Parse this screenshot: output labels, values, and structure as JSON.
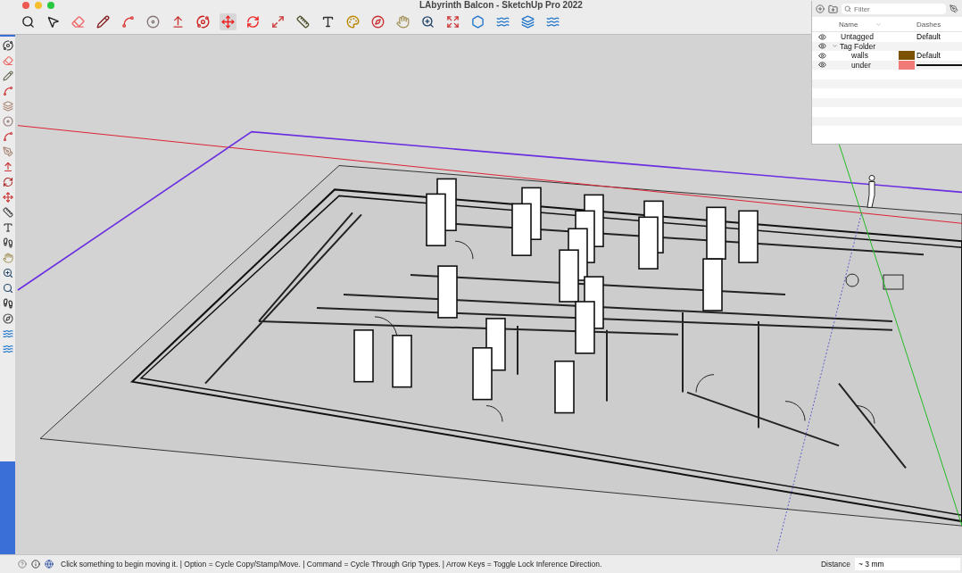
{
  "window": {
    "title": "LAbyrinth Balcon - SketchUp Pro 2022"
  },
  "tags_panel": {
    "filter": {
      "placeholder": "Filter"
    },
    "columns": [
      "Name",
      "Dashes"
    ],
    "rows": [
      {
        "name": "Untagged",
        "visible": true,
        "dashes": "Default"
      },
      {
        "name": "Tag Folder",
        "visible": true,
        "expanded": true,
        "children": [
          {
            "name": "walls",
            "visible": true,
            "color": "#7a5200",
            "dashes": "Default"
          },
          {
            "name": "under",
            "visible": true,
            "color": "#f07a78"
          }
        ]
      }
    ]
  },
  "status_bar": {
    "message": "Click something to begin moving it. | Option = Cycle Copy/Stamp/Move. | Command = Cycle Through Grip Types. | Arrow Keys = Toggle Lock Inference Direction.",
    "measurement_label": "Distance",
    "measurement_value": "~ 3 mm"
  }
}
